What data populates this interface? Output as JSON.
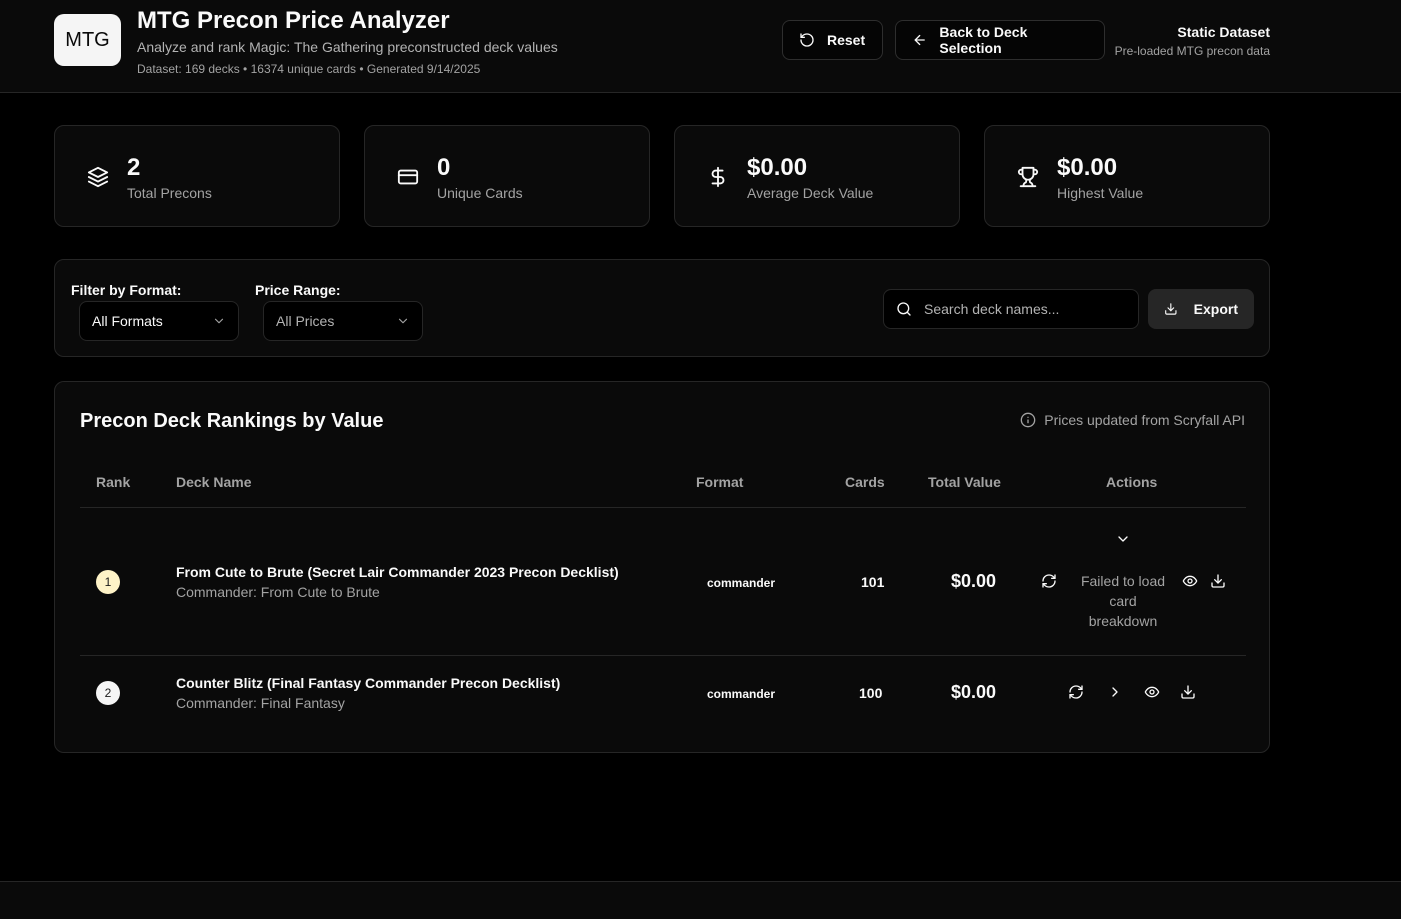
{
  "header": {
    "logo_text": "MTG",
    "title": "MTG Precon Price Analyzer",
    "subtitle": "Analyze and rank Magic: The Gathering preconstructed deck values",
    "meta": "Dataset: 169 decks • 16374 unique cards • Generated 9/14/2025",
    "reset_label": "Reset",
    "back_label": "Back to Deck Selection",
    "dataset_title": "Static Dataset",
    "dataset_subtitle": "Pre-loaded MTG precon data"
  },
  "stats": [
    {
      "value": "2",
      "label": "Total Precons",
      "icon": "layers-icon"
    },
    {
      "value": "0",
      "label": "Unique Cards",
      "icon": "card-icon"
    },
    {
      "value": "$0.00",
      "label": "Average Deck Value",
      "icon": "dollar-icon"
    },
    {
      "value": "$0.00",
      "label": "Highest Value",
      "icon": "trophy-icon"
    }
  ],
  "filters": {
    "format_label": "Filter by Format:",
    "format_value": "All Formats",
    "price_label": "Price Range:",
    "price_value": "All Prices",
    "search_placeholder": "Search deck names...",
    "export_label": "Export"
  },
  "rankings": {
    "title": "Precon Deck Rankings by Value",
    "note": "Prices updated from Scryfall API",
    "columns": [
      "Rank",
      "Deck Name",
      "Format",
      "Cards",
      "Total Value",
      "Actions"
    ],
    "rows": [
      {
        "rank": "1",
        "name": "From Cute to Brute (Secret Lair Commander 2023 Precon Decklist)",
        "sub": "Commander: From Cute to Brute",
        "format": "commander",
        "cards": "101",
        "value": "$0.00",
        "error": "Failed to load card breakdown"
      },
      {
        "rank": "2",
        "name": "Counter Blitz (Final Fantasy Commander Precon Decklist)",
        "sub": "Commander: Final Fantasy",
        "format": "commander",
        "cards": "100",
        "value": "$0.00"
      }
    ]
  },
  "colors": {
    "background": "#000000",
    "panel": "#0a0a0a",
    "border": "#262626",
    "rank_1_badge": "#fef3c7",
    "rank_2_badge": "#f5f5f5"
  }
}
